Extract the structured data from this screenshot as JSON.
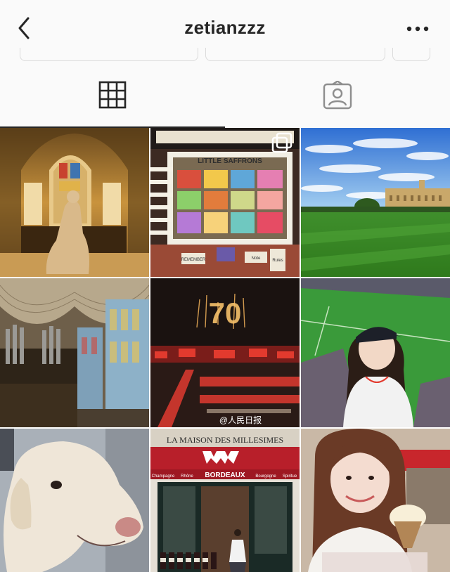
{
  "header": {
    "username": "zetianzzz",
    "back_icon": "chevron-left-icon",
    "more_icon": "more-horizontal-icon"
  },
  "tabs": [
    {
      "icon": "grid-icon",
      "active": true
    },
    {
      "icon": "tagged-user-icon",
      "active": false
    }
  ],
  "posts": [
    {
      "subject": "statue-in-arched-chapel",
      "multi": false
    },
    {
      "subject": "little-saffrons-shopfront",
      "multi": true,
      "shop_sign": "LITTLE SAFFRONS",
      "sign_1": "REMEMBER",
      "sign_2": "Note",
      "sign_3": "Rules"
    },
    {
      "subject": "college-lawn-blue-sky",
      "multi": false
    },
    {
      "subject": "fan-vaulted-chapel-organ",
      "multi": false
    },
    {
      "subject": "fireworks-ceremony-70",
      "multi": false,
      "fireworks_text": "70",
      "watermark": "@人民日报"
    },
    {
      "subject": "woman-in-cap-at-stadium",
      "multi": false
    },
    {
      "subject": "white-dog-portrait",
      "multi": false
    },
    {
      "subject": "la-maison-des-millesimes",
      "multi": false,
      "store_name": "LA MAISON DES MILLESIMES",
      "awning": "BORDEAUX",
      "awning_left": "Champagne",
      "awning_mid": "Rhône",
      "awning_right": "Bourgogne",
      "awning_far": "Spiritue"
    },
    {
      "subject": "woman-with-ice-cream",
      "multi": false
    }
  ]
}
